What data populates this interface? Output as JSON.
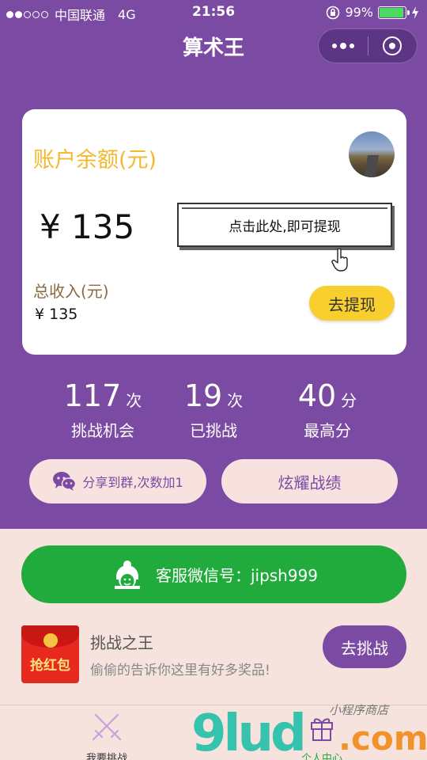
{
  "status_bar": {
    "carrier": "中国联通",
    "network": "4G",
    "time": "21:56",
    "battery": "99%",
    "signal_bars_filled": 2,
    "signal_bars_total": 5
  },
  "nav": {
    "title": "算术王"
  },
  "card": {
    "balance_label": "账户余额(元)",
    "balance": "¥ 135",
    "tip": "点击此处,即可提现",
    "income_label": "总收入(元)",
    "income": "¥ 135",
    "withdraw_button": "去提现"
  },
  "stats": [
    {
      "value": "117",
      "unit": "次",
      "label": "挑战机会"
    },
    {
      "value": "19",
      "unit": "次",
      "label": "已挑战"
    },
    {
      "value": "40",
      "unit": "分",
      "label": "最高分"
    }
  ],
  "share_button": "分享到群,次数加1",
  "show_button": "炫耀战绩",
  "service": {
    "text": "客服微信号：jipsh999"
  },
  "promo": {
    "icon_text": "抢红包",
    "title": "挑战之王",
    "desc": "偷偷的告诉你这里有好多奖品!",
    "button": "去挑战"
  },
  "tabs": [
    {
      "label": "我要挑战",
      "icon": "crossed-swords-icon"
    },
    {
      "label": "个人中心",
      "icon": "gift-icon"
    }
  ],
  "watermark": {
    "brand": "9lud",
    "domain": ".com",
    "tag": "小程序商店"
  },
  "colors": {
    "purple": "#7b4aa3",
    "yellow": "#f8cf2e",
    "green": "#21ab3c",
    "pink_bg": "#f6e3de"
  }
}
